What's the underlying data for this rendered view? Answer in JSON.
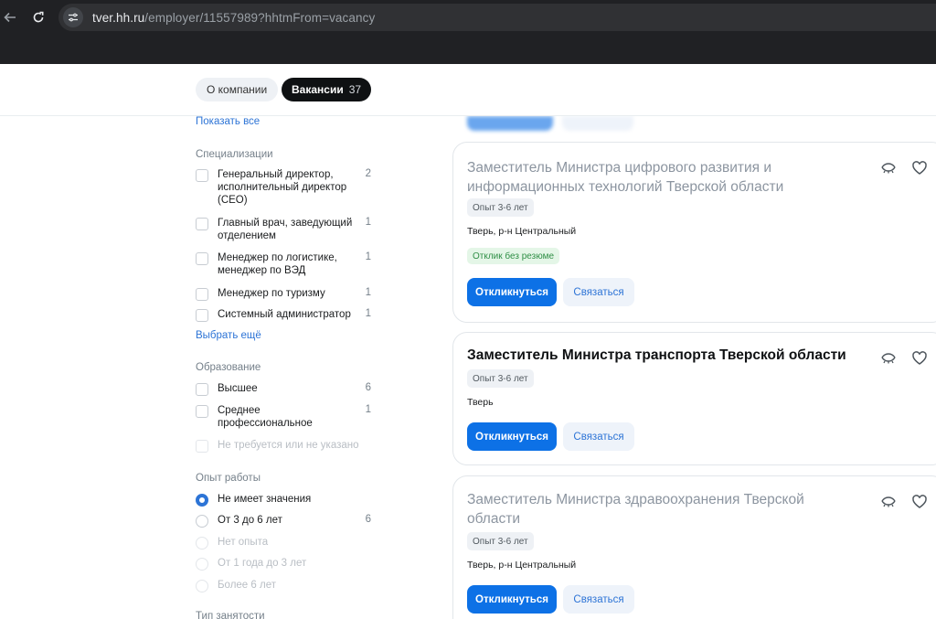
{
  "browser": {
    "url_host": "tver.hh.ru",
    "url_path": "/employer/11557989?hhtmFrom=vacancy"
  },
  "tabs": {
    "about": "О компании",
    "vacancies": "Вакансии",
    "vacancies_count": "37"
  },
  "sidebar": {
    "show_all": "Показать все",
    "specializations": {
      "title": "Специализации",
      "items": [
        {
          "label": "Генеральный директор, исполнительный директор (CEO)",
          "count": "2"
        },
        {
          "label": "Главный врач, заведующий отделением",
          "count": "1"
        },
        {
          "label": "Менеджер по логистике, менеджер по ВЭД",
          "count": "1"
        },
        {
          "label": "Менеджер по туризму",
          "count": "1"
        },
        {
          "label": "Системный администратор",
          "count": "1"
        }
      ],
      "more": "Выбрать ещё"
    },
    "education": {
      "title": "Образование",
      "items": [
        {
          "label": "Высшее",
          "count": "6"
        },
        {
          "label": "Среднее профессиональное",
          "count": "1"
        },
        {
          "label": "Не требуется или не указано",
          "count": ""
        }
      ]
    },
    "experience": {
      "title": "Опыт работы",
      "items": [
        {
          "label": "Не имеет значения",
          "count": "",
          "selected": true
        },
        {
          "label": "От 3 до 6 лет",
          "count": "6"
        },
        {
          "label": "Нет опыта",
          "count": ""
        },
        {
          "label": "От 1 года до 3 лет",
          "count": ""
        },
        {
          "label": "Более 6 лет",
          "count": ""
        }
      ]
    },
    "employment_title": "Тип занятости"
  },
  "vacancies": [
    {
      "title": "Заместитель Министра цифрового развития и информационных технологий Тверской области",
      "experience": "Опыт 3-6 лет",
      "location": "Тверь, р-н Центральный",
      "badge": "Отклик без резюме",
      "respond": "Откликнуться",
      "contact": "Связаться"
    },
    {
      "title": "Заместитель Министра транспорта Тверской области",
      "experience": "Опыт 3-6 лет",
      "location": "Тверь",
      "respond": "Откликнуться",
      "contact": "Связаться"
    },
    {
      "title": "Заместитель Министра здравоохранения Тверской области",
      "experience": "Опыт 3-6 лет",
      "location": "Тверь, р-н Центральный",
      "respond": "Откликнуться",
      "contact": "Связаться"
    }
  ],
  "colors": {
    "accent": "#0d71e6",
    "link": "#2d74d6",
    "badge_green": "#2f8f46"
  }
}
